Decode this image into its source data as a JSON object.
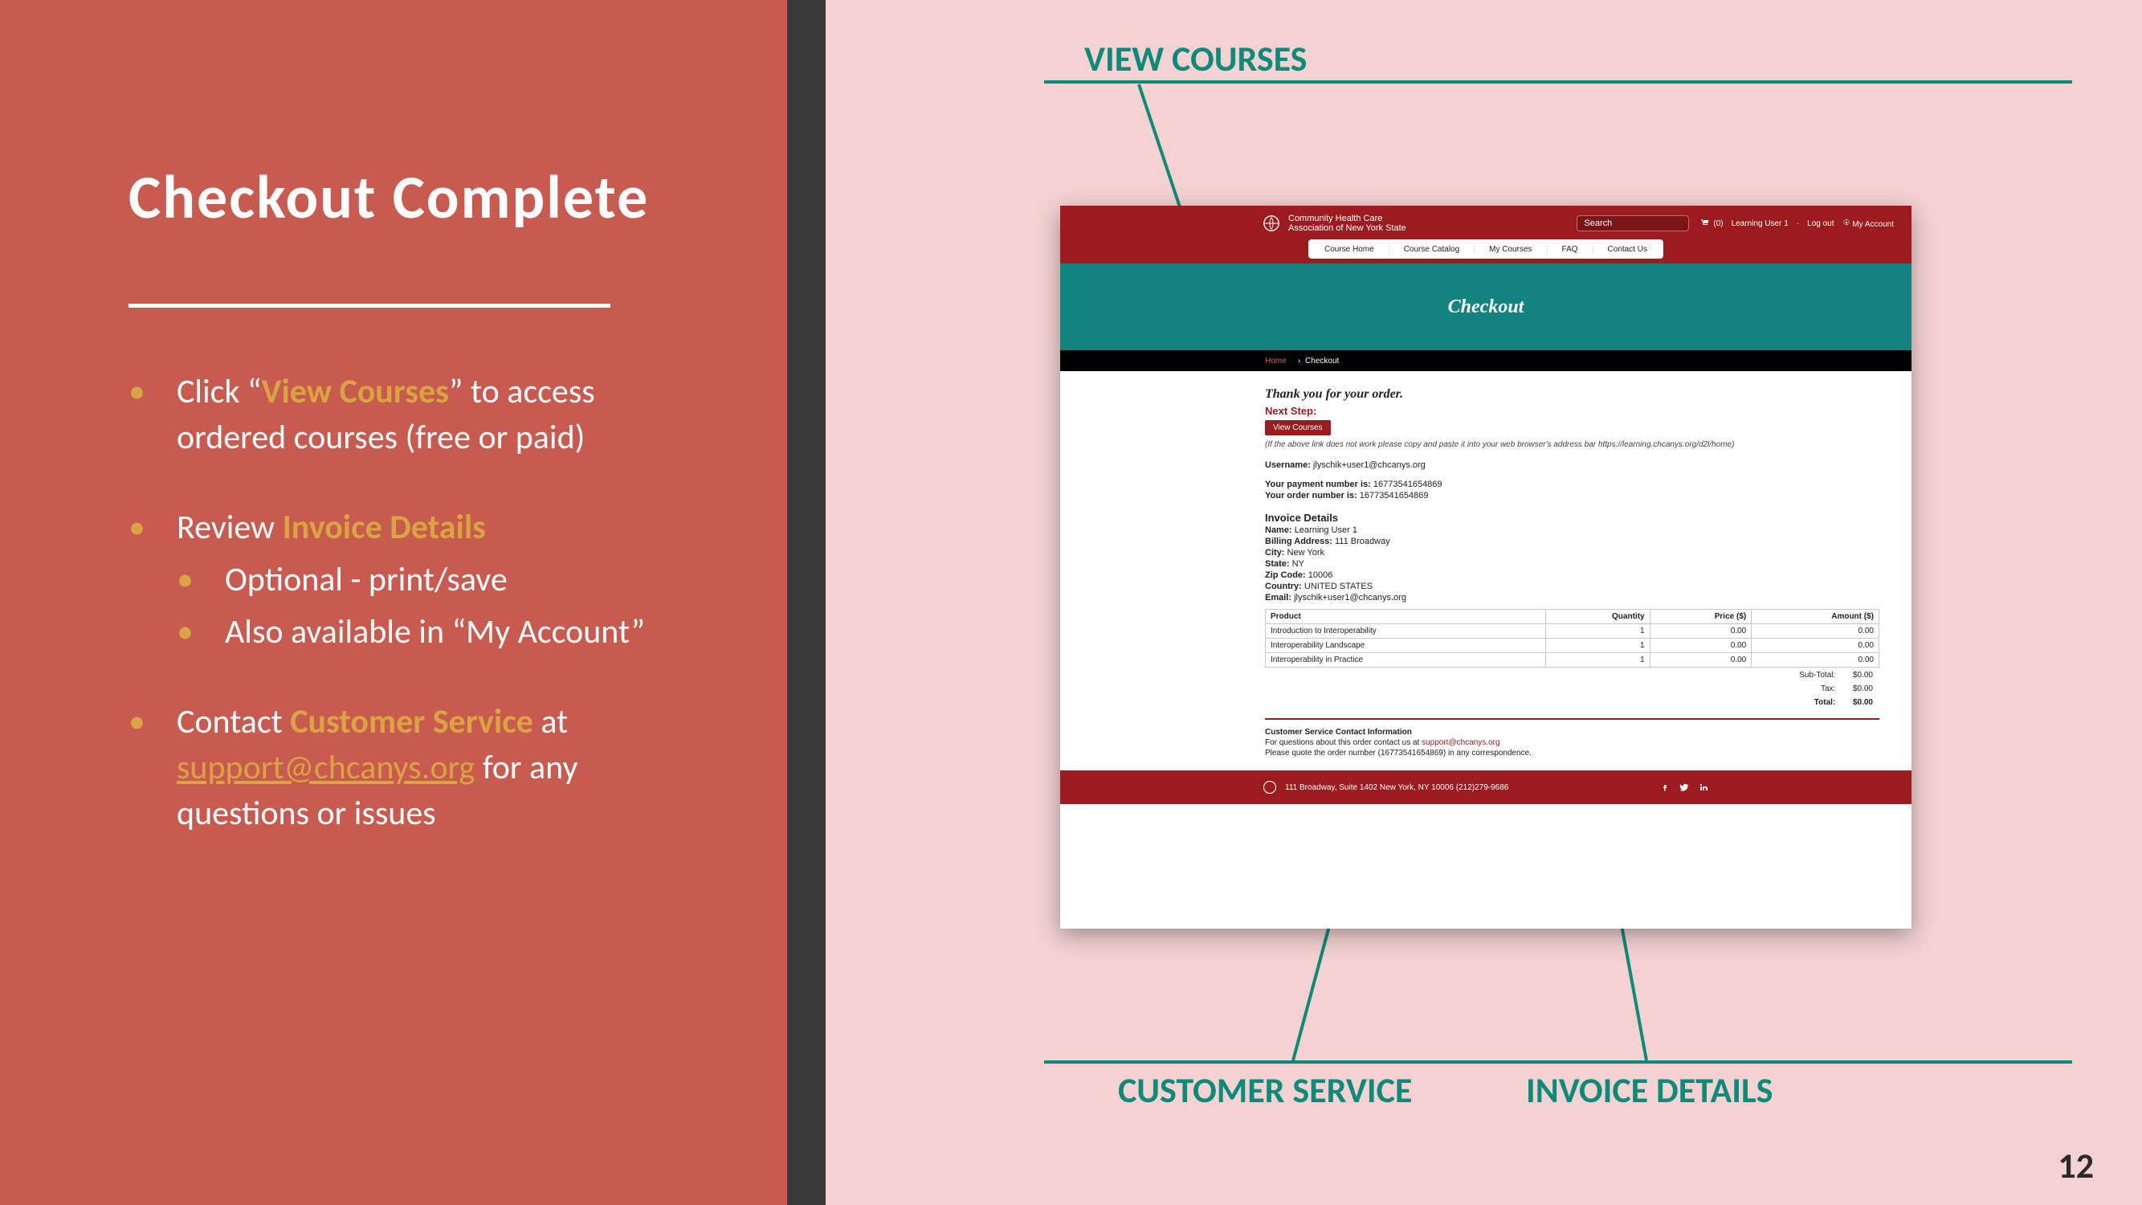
{
  "slide": {
    "title": "Checkout Complete",
    "page_number": "12"
  },
  "bullets": [
    {
      "pre": "Click “",
      "em": "View Courses",
      "post": "” to access ordered courses (free or paid)",
      "sub": []
    },
    {
      "pre": "Review ",
      "em": "Invoice Details",
      "post": "",
      "sub": [
        {
          "pre": "Optional - print/save",
          "em": "",
          "post": ""
        },
        {
          "pre": "Also available in “My Account”",
          "em": "",
          "post": ""
        }
      ]
    },
    {
      "pre": "Contact ",
      "em": "Customer Service",
      "post": " at ",
      "link_text": "support@chcanys.org",
      "tail": " for any questions or issues",
      "sub": []
    }
  ],
  "callouts": {
    "top": "VIEW COURSES",
    "bottom_left": "CUSTOMER SERVICE",
    "bottom_right": "INVOICE DETAILS"
  },
  "screenshot": {
    "org_line1": "Community Health Care",
    "org_line2": "Association of New York State",
    "search_placeholder": "Search",
    "cart_count": "(0)",
    "user_label": "Learning User 1",
    "logout_label": "Log out",
    "my_account_label": "My Account",
    "menu": [
      "Course Home",
      "Course Catalog",
      "My Courses",
      "FAQ",
      "Contact Us"
    ],
    "hero_title": "Checkout",
    "breadcrumb_home": "Home",
    "breadcrumb_sep": "›",
    "breadcrumb_current": "Checkout",
    "thank_you": "Thank you for your order.",
    "next_step_label": "Next Step:",
    "view_courses_btn": "View Courses",
    "note": "(If the above link does not work please copy and paste it into your web browser's address bar https://learning.chcanys.org/d2l/home)",
    "username_label": "Username:",
    "username_value": "jlyschik+user1@chcanys.org",
    "payment_label": "Your payment number is:",
    "payment_value": "16773541654869",
    "order_label": "Your order number is:",
    "order_value": "16773541654869",
    "invoice_heading": "Invoice Details",
    "name_label": "Name:",
    "name_value": "Learning User 1",
    "billing_label": "Billing Address:",
    "billing_value": "111 Broadway",
    "city_label": "City:",
    "city_value": "New York",
    "state_label": "State:",
    "state_value": "NY",
    "zip_label": "Zip Code:",
    "zip_value": "10006",
    "country_label": "Country:",
    "country_value": "UNITED STATES",
    "email_label": "Email:",
    "email_value": "jlyschik+user1@chcanys.org",
    "table_headers": [
      "Product",
      "Quantity",
      "Price ($)",
      "Amount ($)"
    ],
    "table_rows": [
      [
        "Introduction to Interoperability",
        "1",
        "0.00",
        "0.00"
      ],
      [
        "Interoperability Landscape",
        "1",
        "0.00",
        "0.00"
      ],
      [
        "Interoperability in Practice",
        "1",
        "0.00",
        "0.00"
      ]
    ],
    "subtotal_label": "Sub-Total:",
    "subtotal_value": "$0.00",
    "tax_label": "Tax:",
    "tax_value": "$0.00",
    "total_label": "Total:",
    "total_value": "$0.00",
    "cs_heading": "Customer Service Contact Information",
    "cs_line1_pre": "For questions about this order contact us at ",
    "cs_email": "support@chcanys.org",
    "cs_line2": "Please quote the order number (16773541654869) in any correspondence.",
    "footer_addr": "111 Broadway, Suite 1402   New York, NY 10006   (212)279-9686"
  }
}
